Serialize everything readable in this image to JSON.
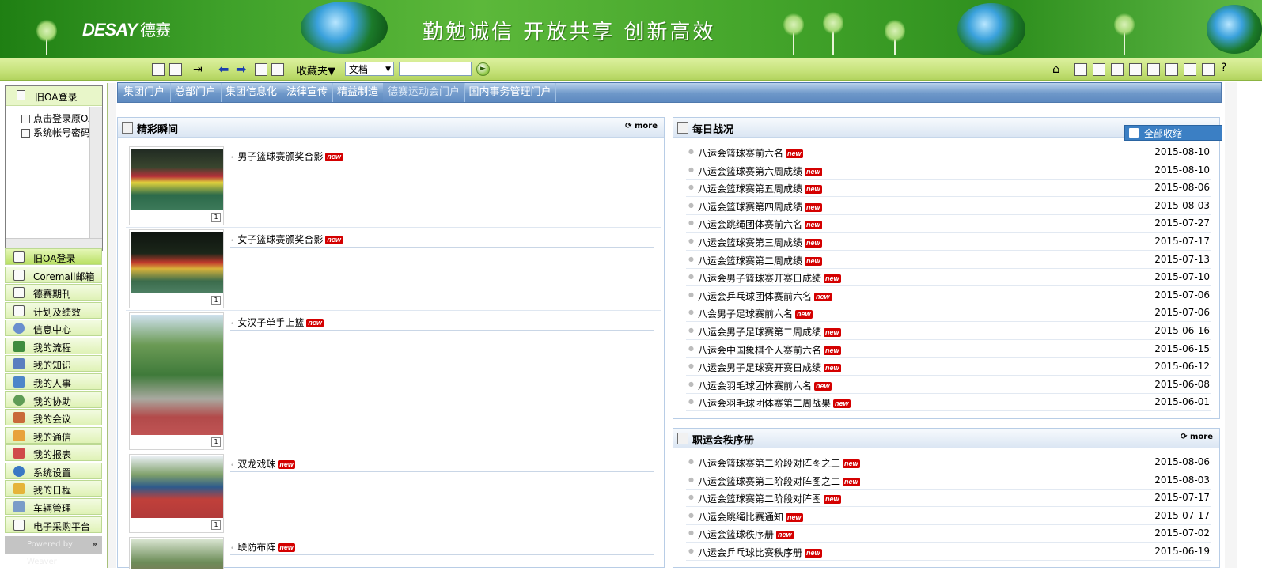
{
  "banner": {
    "brand": "DESAY",
    "brand_cn": "德赛",
    "slogan": "勤勉诚信  开放共享  创新高效"
  },
  "toolbar": {
    "favorites_label": "收藏夹▼",
    "doc_type": "文档",
    "search_value": ""
  },
  "left": {
    "tree_title": "旧OA登录",
    "tree_nodes": [
      "点击登录原OA",
      "系统帐号密码"
    ],
    "nav": [
      {
        "label": "旧OA登录",
        "icon": "doc-icon"
      },
      {
        "label": "Coremail邮箱",
        "icon": "mail-icon"
      },
      {
        "label": "德赛期刊",
        "icon": "journal-icon"
      },
      {
        "label": "计划及绩效",
        "icon": "plan-icon"
      },
      {
        "label": "信息中心",
        "icon": "info-icon"
      },
      {
        "label": "我的流程",
        "icon": "flow-icon"
      },
      {
        "label": "我的知识",
        "icon": "book-icon"
      },
      {
        "label": "我的人事",
        "icon": "hr-icon"
      },
      {
        "label": "我的协助",
        "icon": "people-icon"
      },
      {
        "label": "我的会议",
        "icon": "meeting-icon"
      },
      {
        "label": "我的通信",
        "icon": "envelope-icon"
      },
      {
        "label": "我的报表",
        "icon": "report-icon"
      },
      {
        "label": "系统设置",
        "icon": "settings-icon"
      },
      {
        "label": "我的日程",
        "icon": "calendar-icon"
      },
      {
        "label": "车辆管理",
        "icon": "car-icon"
      },
      {
        "label": "电子采购平台",
        "icon": "purchase-icon"
      }
    ],
    "powered": "Powered by Weaver",
    "expand": "»"
  },
  "tabs": [
    "集团门户",
    "总部门户",
    "集团信息化",
    "法律宣传",
    "精益制造",
    "德赛运动会门户",
    "国内事务管理门户"
  ],
  "highlights": {
    "title": "精彩瞬间",
    "more": "more",
    "new": "new",
    "thumb_count": "1",
    "items": [
      "男子篮球赛颁奖合影",
      "女子篮球赛颁奖合影",
      "女汉子单手上篮",
      "双龙戏珠",
      "联防布阵"
    ]
  },
  "daily": {
    "title": "每日战况",
    "collapse_label": "全部收缩",
    "new": "new",
    "items": [
      {
        "title": "八运会篮球赛前六名",
        "date": "2015-08-10"
      },
      {
        "title": "八运会篮球赛第六周成绩",
        "date": "2015-08-10"
      },
      {
        "title": "八运会篮球赛第五周成绩",
        "date": "2015-08-06"
      },
      {
        "title": "八运会篮球赛第四周成绩",
        "date": "2015-08-03"
      },
      {
        "title": "八运会跳绳团体赛前六名",
        "date": "2015-07-27"
      },
      {
        "title": "八运会篮球赛第三周成绩",
        "date": "2015-07-17"
      },
      {
        "title": "八运会篮球赛第二周成绩",
        "date": "2015-07-13"
      },
      {
        "title": "八运会男子篮球赛开赛日成绩",
        "date": "2015-07-10"
      },
      {
        "title": "八运会乒乓球团体赛前六名",
        "date": "2015-07-06"
      },
      {
        "title": "八会男子足球赛前六名",
        "date": "2015-07-06"
      },
      {
        "title": "八运会男子足球赛第二周成绩",
        "date": "2015-06-16"
      },
      {
        "title": "八运会中国象棋个人赛前六名",
        "date": "2015-06-15"
      },
      {
        "title": "八运会男子足球赛开赛日成绩",
        "date": "2015-06-12"
      },
      {
        "title": "八运会羽毛球团体赛前六名",
        "date": "2015-06-08"
      },
      {
        "title": "八运会羽毛球团体赛第二周战果",
        "date": "2015-06-01"
      }
    ]
  },
  "schedule": {
    "title": "职运会秩序册",
    "more": "more",
    "new": "new",
    "items": [
      {
        "title": "八运会篮球赛第二阶段对阵图之三",
        "date": "2015-08-06"
      },
      {
        "title": "八运会篮球赛第二阶段对阵图之二",
        "date": "2015-08-03"
      },
      {
        "title": "八运会篮球赛第二阶段对阵图",
        "date": "2015-07-17"
      },
      {
        "title": "八运会跳绳比赛通知",
        "date": "2015-07-17"
      },
      {
        "title": "八运会篮球秩序册",
        "date": "2015-07-02"
      },
      {
        "title": "八运会乒乓球比赛秩序册",
        "date": "2015-06-19"
      }
    ]
  }
}
